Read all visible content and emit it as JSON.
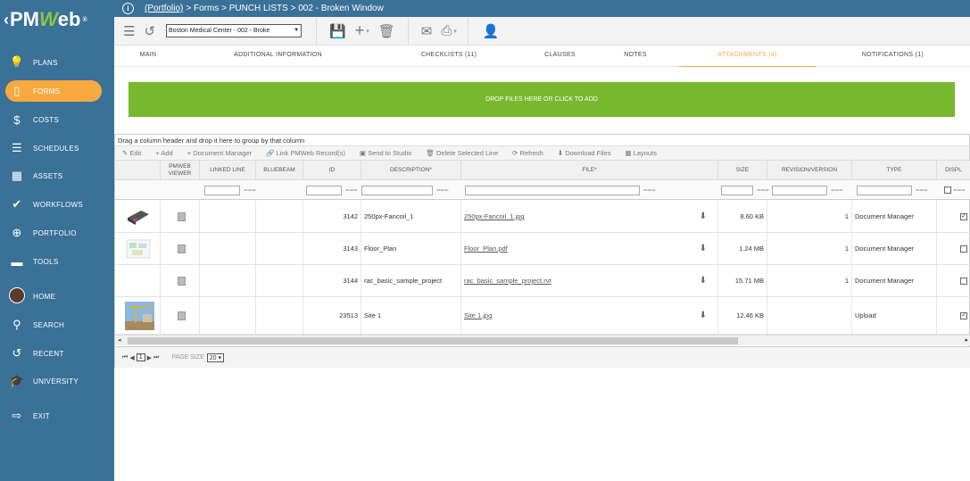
{
  "sidebar": {
    "logo": {
      "chevron": "‹",
      "pm": "PM",
      "w": "W",
      "eb": "eb",
      "reg": "®"
    },
    "items": [
      {
        "label": "PLANS",
        "icon": "lightbulb-icon",
        "glyph": "💡"
      },
      {
        "label": "FORMS",
        "icon": "forms-icon",
        "glyph": "▯",
        "active": true
      },
      {
        "label": "COSTS",
        "icon": "dollar-icon",
        "glyph": "$"
      },
      {
        "label": "SCHEDULES",
        "icon": "schedule-icon",
        "glyph": "☰"
      },
      {
        "label": "ASSETS",
        "icon": "building-icon",
        "glyph": "▦"
      },
      {
        "label": "WORKFLOWS",
        "icon": "check-icon",
        "glyph": "✔"
      },
      {
        "label": "PORTFOLIO",
        "icon": "globe-icon",
        "glyph": "⊕"
      },
      {
        "label": "TOOLS",
        "icon": "toolbox-icon",
        "glyph": "▬"
      },
      {
        "label": "HOME",
        "icon": "avatar-icon",
        "glyph": ""
      },
      {
        "label": "SEARCH",
        "icon": "search-icon",
        "glyph": "⚲"
      },
      {
        "label": "RECENT",
        "icon": "history-icon",
        "glyph": "↺"
      },
      {
        "label": "UNIVERSITY",
        "icon": "graduation-cap-icon",
        "glyph": "🎓"
      },
      {
        "label": "EXIT",
        "icon": "exit-icon",
        "glyph": "⇨"
      }
    ]
  },
  "header": {
    "info": "i",
    "breadcrumb_link": "(Portfolio)",
    "breadcrumb_rest": "> Forms > PUNCH LISTS > 002 - Broken Window"
  },
  "toolbar": {
    "record_select": "Boston Medical Center - 002 - Broke"
  },
  "tabs": [
    {
      "label": "MAIN"
    },
    {
      "label": "ADDITIONAL INFORMATION"
    },
    {
      "label": "CHECKLISTS (11)"
    },
    {
      "label": "CLAUSES"
    },
    {
      "label": "NOTES"
    },
    {
      "label": "ATTACHMENTS (4)",
      "active": true
    },
    {
      "label": "NOTIFICATIONS (1)"
    }
  ],
  "dropzone": {
    "label": "DROP FILES HERE OR CLICK TO ADD"
  },
  "grid": {
    "group_hint": "Drag a column header and drop it here to group by that column",
    "tools": [
      "Edit",
      "+ Add",
      "+ Document Manager",
      "Link PMWeb Record(s)",
      "Send to Studio",
      "Delete Selected Line",
      "Refresh",
      "Download Files",
      "Layouts"
    ],
    "columns": [
      "",
      "PMWEB VIEWER",
      "LINKED LINE",
      "BLUEBEAM",
      "ID",
      "DESCRIPTION*",
      "FILE*",
      "SIZE",
      "REVISION/VERSION",
      "TYPE",
      "DISPL"
    ],
    "rows": [
      {
        "id": "3142",
        "desc": "250px-Fancoil_1",
        "file": "250px-Fancoil_1.jpg",
        "size": "8.60 KB",
        "rev": "1",
        "type": "Document Manager",
        "checked": true,
        "thumb": "fancoil"
      },
      {
        "id": "3143",
        "desc": "Floor_Plan",
        "file": "Floor_Plan.pdf",
        "size": "1.24 MB",
        "rev": "1",
        "type": "Document Manager",
        "checked": false,
        "thumb": "plan"
      },
      {
        "id": "3144",
        "desc": "rac_basic_sample_project",
        "file": "rac_basic_sample_project.rvt",
        "size": "15.71 MB",
        "rev": "1",
        "type": "Document Manager",
        "checked": false,
        "thumb": ""
      },
      {
        "id": "23513",
        "desc": "Site 1",
        "file": "Site 1.jpg",
        "size": "12.46 KB",
        "rev": "",
        "type": "Upload",
        "checked": true,
        "thumb": "site"
      }
    ],
    "pager": {
      "page": "1",
      "page_size_label": "PAGE SIZE",
      "page_size": "20"
    }
  }
}
